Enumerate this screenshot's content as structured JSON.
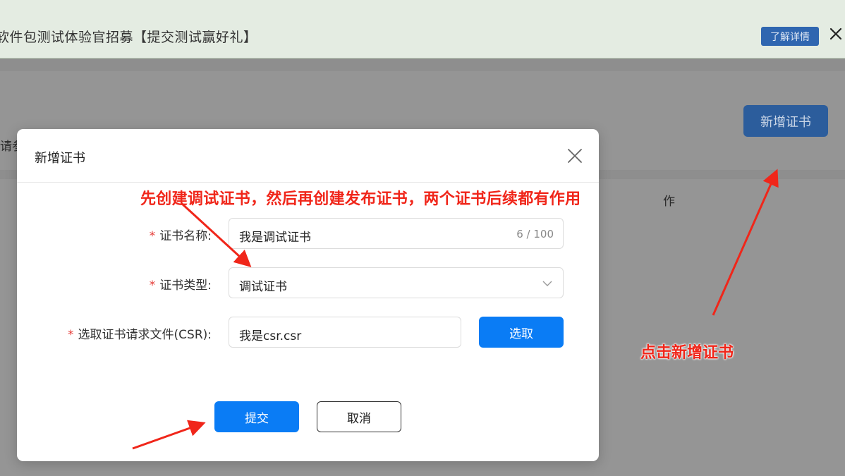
{
  "banner": {
    "text": "软件包测试体验官招募【提交测试赢好礼】",
    "details_label": "了解详情",
    "close_icon": "close-icon"
  },
  "page": {
    "new_cert_label": "新增证书",
    "left_fragment": "请参",
    "right_fragment": "作"
  },
  "modal": {
    "title": "新增证书",
    "fields": {
      "cert_name": {
        "label": "证书名称:",
        "value": "我是调试证书",
        "count": "6 / 100"
      },
      "cert_type": {
        "label": "证书类型:",
        "value": "调试证书"
      },
      "csr_file": {
        "label": "选取证书请求文件(CSR):",
        "value": "我是csr.csr",
        "pick_label": "选取"
      }
    },
    "required_mark": "*",
    "submit_label": "提交",
    "cancel_label": "取消"
  },
  "annotations": {
    "top": "先创建调试证书，然后再创建发布证书，两个证书后续都有作用",
    "right": "点击新增证书"
  },
  "colors": {
    "primary": "#0a7cf5",
    "annotation": "#f0261a",
    "required": "#e53935"
  }
}
